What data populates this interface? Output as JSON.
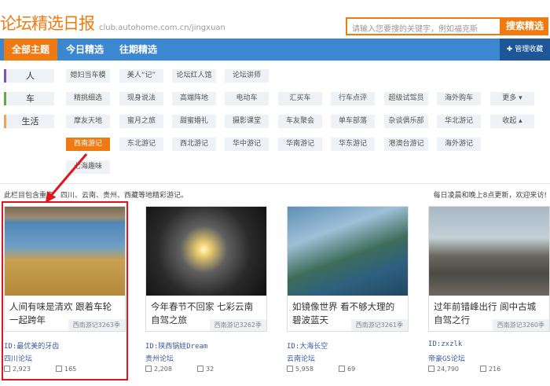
{
  "header": {
    "logo": "论坛精选日报",
    "url": "club.autohome.com.cn/jingxuan",
    "search_placeholder": "请输入您要搜的关键字，例如福克斯",
    "search_button": "搜索精选"
  },
  "nav": {
    "tabs": [
      "全部主题",
      "今日精选",
      "往期精选"
    ],
    "manage": "✚ 管理收藏"
  },
  "categories": [
    {
      "label": "人",
      "color": "#7b4fd1",
      "tags": [
        "媳妇当车模",
        "美人“记”",
        "论坛红人馆",
        "论坛讲师"
      ]
    },
    {
      "label": "车",
      "color": "#5cae3e",
      "tags": [
        "精挑细选",
        "现身说法",
        "高端阵地",
        "电动车",
        "汇买车",
        "行车点评",
        "超级试驾员",
        "海外购车",
        "更多 ▾"
      ]
    },
    {
      "label": "生活",
      "color": "#f2a05a",
      "tags": [
        "摩友天地",
        "蜜月之旅",
        "甜蜜婚礼",
        "摄影课堂",
        "车友聚会",
        "单车部落",
        "杂谈俱乐部",
        "华北游记",
        "收起 ▴"
      ]
    }
  ],
  "extra_tags": {
    "row4": [
      "西南游记",
      "东北游记",
      "西北游记",
      "华中游记",
      "华南游记",
      "华东游记",
      "港澳台游记",
      "海外游记"
    ],
    "row5": [
      "七海趣味"
    ]
  },
  "notes": {
    "left": "此栏目包含重庆、四川、云南、贵州、西藏等地精彩游记。",
    "right": "每日凌晨和晚上8点更新，欢迎来访!"
  },
  "cards": [
    {
      "title": "人间有味是清欢 跟着车轮一起跨年",
      "tag": "西南游记3263季",
      "id": "ID:最优美的牙齿",
      "forum": "四川论坛",
      "likes": "2,923",
      "comments": "165"
    },
    {
      "title": "今年春节不回家 七彩云南自驾之旅",
      "tag": "西南游记3262季",
      "id": "ID:陕西锅娃Dream",
      "forum": "贵州论坛",
      "likes": "2,208",
      "comments": "32"
    },
    {
      "title": "如镜像世界 看不够大理的碧波蓝天",
      "tag": "西南游记3261季",
      "id": "ID:大海长空",
      "forum": "云南论坛",
      "likes": "5,958",
      "comments": "69"
    },
    {
      "title": "过年前错峰出行 阆中古城自驾之行",
      "tag": "西南游记3260季",
      "id": "ID:zxzlk",
      "forum": "帝豪GS论坛",
      "likes": "24,790",
      "comments": "216"
    }
  ]
}
